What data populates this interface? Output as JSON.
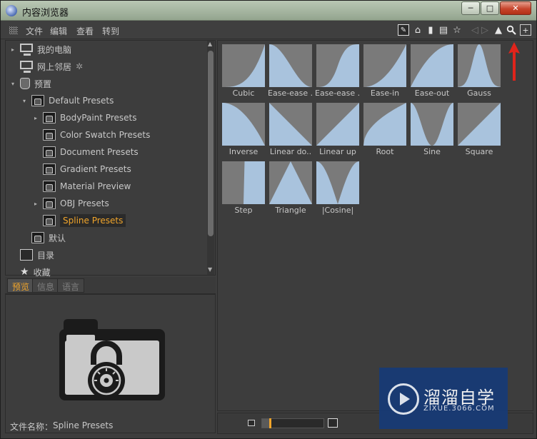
{
  "window": {
    "title": "内容浏览器",
    "min_glyph": "─",
    "max_glyph": "□",
    "close_glyph": "✕"
  },
  "menu": {
    "file": "文件",
    "edit": "编辑",
    "view": "查看",
    "goto": "转到"
  },
  "toolbar": {
    "icons": [
      "edit-icon",
      "home-icon",
      "jar-icon",
      "book-icon",
      "star-icon",
      "back-forward-icon",
      "navigate-arrow-icon",
      "search-icon",
      "new-window-icon"
    ]
  },
  "tree": [
    {
      "label": "我的电脑",
      "icon": "computer-icon"
    },
    {
      "label": "网上邻居",
      "icon": "network-icon"
    },
    {
      "label": "预置",
      "icon": "jar-icon"
    },
    {
      "label": "Default Presets",
      "icon": "folder-icon"
    },
    {
      "label": "BodyPaint Presets",
      "icon": "folder-icon"
    },
    {
      "label": "Color Swatch Presets",
      "icon": "folder-icon"
    },
    {
      "label": "Document Presets",
      "icon": "folder-icon"
    },
    {
      "label": "Gradient Presets",
      "icon": "folder-icon"
    },
    {
      "label": "Material Preview",
      "icon": "folder-icon"
    },
    {
      "label": "OBJ Presets",
      "icon": "folder-icon"
    },
    {
      "label": "Spline Presets",
      "icon": "folder-icon"
    },
    {
      "label": "默认",
      "icon": "folder-icon"
    },
    {
      "label": "目录",
      "icon": "book-icon"
    },
    {
      "label": "收藏",
      "icon": "star-icon"
    }
  ],
  "selected_item": "Spline Presets",
  "tabs": {
    "preview": "预览",
    "info": "信息",
    "lang": "语言"
  },
  "preview": {
    "file_label": "文件名称：",
    "file_name": "Spline Presets"
  },
  "presets": [
    {
      "label": "Cubic",
      "curve": "cubic"
    },
    {
      "label": "Ease-ease ..",
      "curve": "easeease"
    },
    {
      "label": "Ease-ease ..",
      "curve": "easeease2"
    },
    {
      "label": "Ease-in",
      "curve": "easein"
    },
    {
      "label": "Ease-out",
      "curve": "easeout"
    },
    {
      "label": "Gauss",
      "curve": "gauss"
    },
    {
      "label": "Inverse",
      "curve": "inverse"
    },
    {
      "label": "Linear do..",
      "curve": "lineardown"
    },
    {
      "label": "Linear up",
      "curve": "linearup"
    },
    {
      "label": "Root",
      "curve": "root"
    },
    {
      "label": "Sine",
      "curve": "sine"
    },
    {
      "label": "Square",
      "curve": "square"
    },
    {
      "label": "Step",
      "curve": "step"
    },
    {
      "label": "Triangle",
      "curve": "triangle"
    },
    {
      "label": "|Cosine|",
      "curve": "abscosine"
    }
  ],
  "thumbnail_size_slider": 0.12,
  "colors": {
    "accent": "#f1a52b",
    "curve_fill": "#a9c3dd",
    "thumb_bg": "#7a7a7a",
    "annotation_arrow": "#e0241b"
  },
  "watermark": {
    "title": "溜溜自学",
    "subtitle": "ZIXUE.3066.COM"
  }
}
